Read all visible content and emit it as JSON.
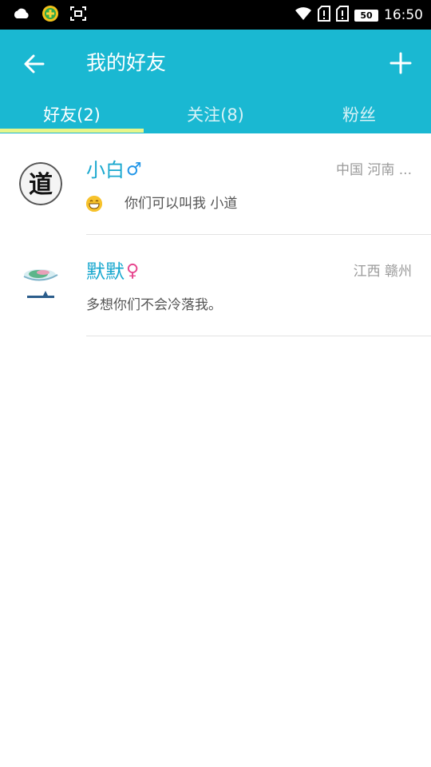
{
  "status_bar": {
    "time": "16:50",
    "battery": "50",
    "icons": [
      "cloud-icon",
      "app-plus-icon",
      "screenshot-icon",
      "wifi-icon",
      "sim1-icon",
      "sim2-icon",
      "battery-icon"
    ]
  },
  "header": {
    "title": "我的好友",
    "back_icon": "arrow-left-icon",
    "add_icon": "plus-icon"
  },
  "tabs": [
    {
      "label": "好友(2)",
      "active": true
    },
    {
      "label": "关注(8)",
      "active": false
    },
    {
      "label": "粉丝",
      "active": false
    }
  ],
  "colors": {
    "header": "#1ab8d2",
    "indicator": "#e7f58a",
    "name": "#19a8cf",
    "male": "#2196e8",
    "female": "#e7468e"
  },
  "friends": [
    {
      "name": "小白",
      "gender_symbol": "♂",
      "location": "中国 河南 ...",
      "message": "你们可以叫我  小道",
      "has_emoji": true,
      "avatar_char": "道"
    },
    {
      "name": "默默",
      "gender_symbol": "♀",
      "location": "江西 赣州",
      "message": "多想你们不会冷落我。",
      "has_emoji": false
    }
  ]
}
